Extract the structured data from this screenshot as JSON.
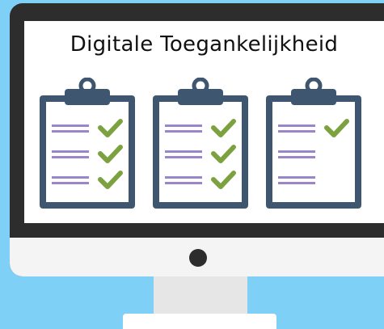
{
  "title": "Digitale Toegankelijkheid",
  "colors": {
    "background": "#7fd0f7",
    "monitor_frame": "#2d2d2d",
    "clipboard": "#3e5670",
    "line": "#9a86c8",
    "check": "#7ba23f"
  },
  "clipboards": [
    {
      "checks": [
        true,
        true,
        true
      ]
    },
    {
      "checks": [
        true,
        true,
        true
      ]
    },
    {
      "checks": [
        true,
        false,
        false
      ]
    }
  ]
}
